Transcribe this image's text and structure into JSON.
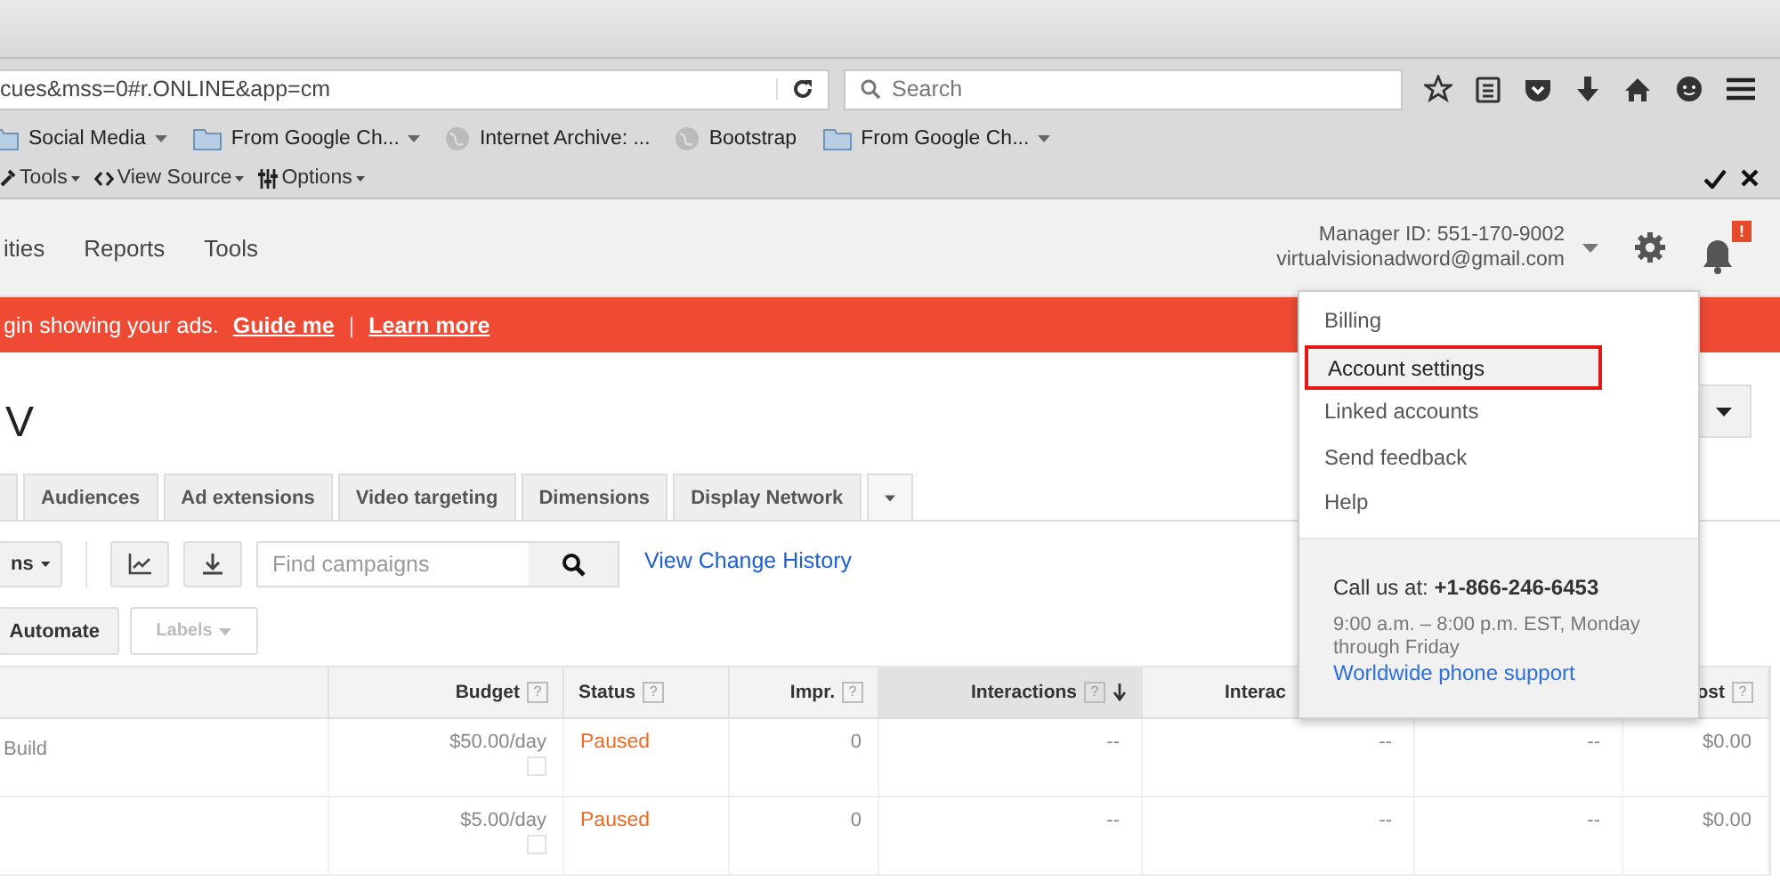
{
  "browser": {
    "url": "cues&mss=0#r.ONLINE&app=cm",
    "search": {
      "placeholder": "Search"
    },
    "bookmarks": [
      {
        "kind": "folder",
        "label": "Social Media",
        "menu": true
      },
      {
        "kind": "folder",
        "label": "From Google Ch...",
        "menu": true
      },
      {
        "kind": "site",
        "label": "Internet Archive: ...",
        "menu": false
      },
      {
        "kind": "site",
        "label": "Bootstrap",
        "menu": false
      },
      {
        "kind": "folder",
        "label": "From Google Ch...",
        "menu": true
      }
    ],
    "toolbar": [
      "Tools",
      "View Source",
      "Options"
    ]
  },
  "header": {
    "nav": [
      "ities",
      "Reports",
      "Tools"
    ],
    "manager_id": "Manager ID: 551-170-9002",
    "email": "virtualvisionadword@gmail.com",
    "notification_badge": "!"
  },
  "banner": {
    "text": "gin showing your ads.",
    "links": [
      "Guide me",
      "Learn more"
    ],
    "separator": "|"
  },
  "page_title": "V",
  "tabs": [
    {
      "selected": false
    },
    {
      "label": "Audiences",
      "selected": false
    },
    {
      "label": "Ad extensions",
      "selected": false
    },
    {
      "label": "Video targeting",
      "selected": false
    },
    {
      "label": "Dimensions",
      "selected": false
    },
    {
      "label": "Display Network",
      "selected": false
    }
  ],
  "controls": {
    "segment_button": "ns",
    "search": {
      "placeholder": "Find campaigns"
    },
    "history_link": "View Change History",
    "automate_button": "Automate",
    "labels_button": {
      "label": "Labels",
      "disabled": true
    }
  },
  "table": {
    "columns": [
      {
        "sorted": false
      },
      {
        "label": "Budget",
        "help": "?",
        "sorted": false
      },
      {
        "label": "Status",
        "help": "?",
        "sorted": false
      },
      {
        "label": "Impr.",
        "help": "?",
        "sorted": false
      },
      {
        "label": "Interactions",
        "help": "?",
        "sorted": true
      },
      {
        "label": "Interac",
        "sorted": false
      },
      null,
      {
        "label": "ost",
        "help": "?",
        "sorted": false
      }
    ],
    "rows": [
      {
        "cells": [
          "Build",
          "$50.00/day",
          "Paused",
          "0",
          "--",
          "--",
          "--",
          "$0.00"
        ]
      },
      {
        "cells": [
          "",
          "$5.00/day",
          "Paused",
          "0",
          "--",
          "--",
          "--",
          "$0.00"
        ]
      }
    ]
  },
  "menu": {
    "items": [
      {
        "label": "Billing",
        "selected": false
      },
      {
        "label": "Account settings",
        "selected": true
      },
      {
        "label": "Linked accounts",
        "selected": false
      },
      {
        "label": "Send feedback",
        "selected": false
      },
      {
        "label": "Help",
        "selected": false
      }
    ],
    "call": "Call us at: **+1-866-246-6453**",
    "hours": "9:00 a.m. – 8:00 p.m. EST, Monday through Friday",
    "support_link": "Worldwide phone support"
  }
}
